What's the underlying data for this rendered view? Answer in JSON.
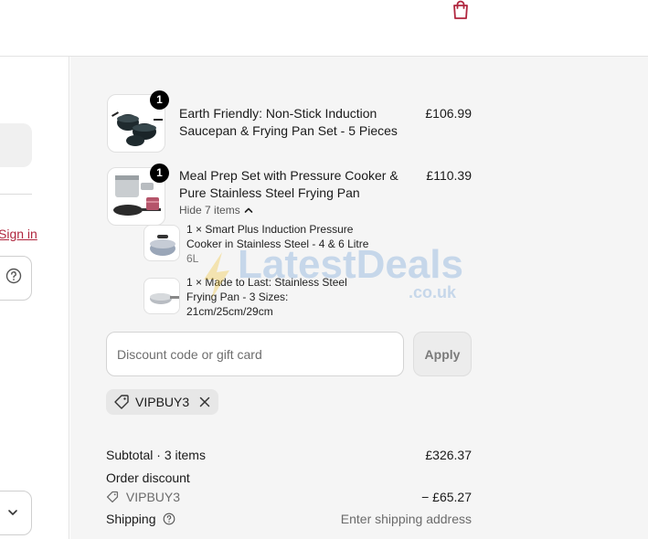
{
  "left": {
    "sign_in": "Sign in"
  },
  "items": [
    {
      "qty": "1",
      "title": "Earth Friendly: Non-Stick Induction Saucepan & Frying Pan Set - 5 Pieces",
      "price": "£106.99"
    },
    {
      "qty": "1",
      "title": "Meal Prep Set with Pressure Cooker & Pure Stainless Steel Frying Pan",
      "price": "£110.39",
      "toggle_label": "Hide 7 items",
      "bundle": [
        {
          "name": "1 × Smart Plus Induction Pressure Cooker in Stainless Steel - 4 & 6 Litre",
          "variant": "6L"
        },
        {
          "name": "1 × Made to Last: Stainless Steel Frying Pan - 3 Sizes: 21cm/25cm/29cm",
          "variant": ""
        }
      ]
    }
  ],
  "discount": {
    "placeholder": "Discount code or gift card",
    "apply_label": "Apply",
    "applied_code": "VIPBUY3"
  },
  "totals": {
    "subtotal_label": "Subtotal · 3 items",
    "subtotal_value": "£326.37",
    "order_discount_label": "Order discount",
    "discount_code": "VIPBUY3",
    "discount_value": "− £65.27",
    "shipping_label": "Shipping",
    "shipping_value": "Enter shipping address"
  },
  "watermark": {
    "line1": "LatestDeals",
    "line2": ".co.uk"
  },
  "colors": {
    "brand_accent": "#b0263e",
    "summary_bg": "#f5f5f5",
    "badge_bg": "#000000"
  },
  "icons": [
    "shopping-bag-icon",
    "help-circle-icon",
    "chevron-down-icon",
    "chevron-up-icon",
    "tag-icon",
    "close-icon"
  ]
}
